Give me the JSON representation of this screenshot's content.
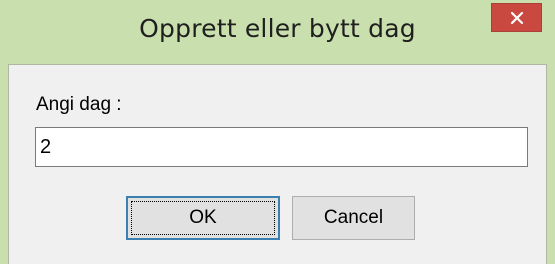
{
  "dialog": {
    "title": "Opprett eller bytt dag",
    "close_symbol": "×",
    "colors": {
      "titlebar_bg": "#c9dfad",
      "close_button_bg": "#c9483f",
      "client_bg": "#f0f0f0",
      "default_button_border": "#3c7fb1"
    }
  },
  "form": {
    "label": "Angi dag :",
    "input_value": "2"
  },
  "buttons": {
    "ok_label": "OK",
    "cancel_label": "Cancel"
  },
  "icons": {
    "close": "close-icon"
  }
}
